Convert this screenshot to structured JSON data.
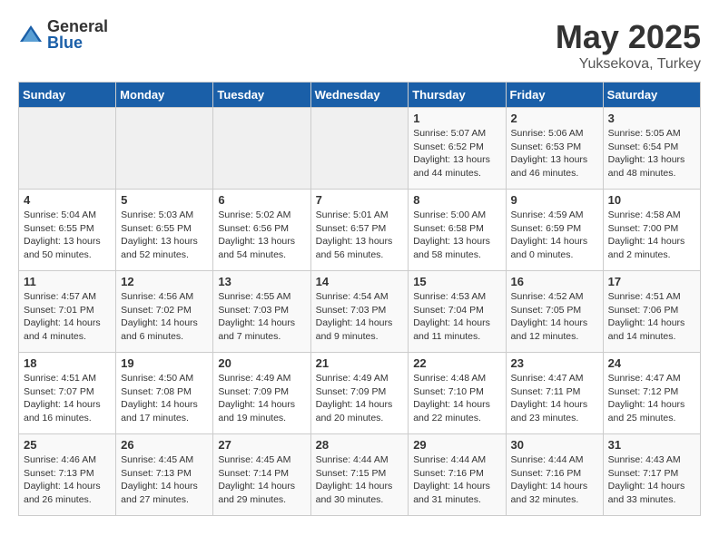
{
  "logo": {
    "general": "General",
    "blue": "Blue"
  },
  "title": "May 2025",
  "location": "Yuksekova, Turkey",
  "days_of_week": [
    "Sunday",
    "Monday",
    "Tuesday",
    "Wednesday",
    "Thursday",
    "Friday",
    "Saturday"
  ],
  "weeks": [
    [
      {
        "day": "",
        "info": ""
      },
      {
        "day": "",
        "info": ""
      },
      {
        "day": "",
        "info": ""
      },
      {
        "day": "",
        "info": ""
      },
      {
        "day": "1",
        "info": "Sunrise: 5:07 AM\nSunset: 6:52 PM\nDaylight: 13 hours\nand 44 minutes."
      },
      {
        "day": "2",
        "info": "Sunrise: 5:06 AM\nSunset: 6:53 PM\nDaylight: 13 hours\nand 46 minutes."
      },
      {
        "day": "3",
        "info": "Sunrise: 5:05 AM\nSunset: 6:54 PM\nDaylight: 13 hours\nand 48 minutes."
      }
    ],
    [
      {
        "day": "4",
        "info": "Sunrise: 5:04 AM\nSunset: 6:55 PM\nDaylight: 13 hours\nand 50 minutes."
      },
      {
        "day": "5",
        "info": "Sunrise: 5:03 AM\nSunset: 6:55 PM\nDaylight: 13 hours\nand 52 minutes."
      },
      {
        "day": "6",
        "info": "Sunrise: 5:02 AM\nSunset: 6:56 PM\nDaylight: 13 hours\nand 54 minutes."
      },
      {
        "day": "7",
        "info": "Sunrise: 5:01 AM\nSunset: 6:57 PM\nDaylight: 13 hours\nand 56 minutes."
      },
      {
        "day": "8",
        "info": "Sunrise: 5:00 AM\nSunset: 6:58 PM\nDaylight: 13 hours\nand 58 minutes."
      },
      {
        "day": "9",
        "info": "Sunrise: 4:59 AM\nSunset: 6:59 PM\nDaylight: 14 hours\nand 0 minutes."
      },
      {
        "day": "10",
        "info": "Sunrise: 4:58 AM\nSunset: 7:00 PM\nDaylight: 14 hours\nand 2 minutes."
      }
    ],
    [
      {
        "day": "11",
        "info": "Sunrise: 4:57 AM\nSunset: 7:01 PM\nDaylight: 14 hours\nand 4 minutes."
      },
      {
        "day": "12",
        "info": "Sunrise: 4:56 AM\nSunset: 7:02 PM\nDaylight: 14 hours\nand 6 minutes."
      },
      {
        "day": "13",
        "info": "Sunrise: 4:55 AM\nSunset: 7:03 PM\nDaylight: 14 hours\nand 7 minutes."
      },
      {
        "day": "14",
        "info": "Sunrise: 4:54 AM\nSunset: 7:03 PM\nDaylight: 14 hours\nand 9 minutes."
      },
      {
        "day": "15",
        "info": "Sunrise: 4:53 AM\nSunset: 7:04 PM\nDaylight: 14 hours\nand 11 minutes."
      },
      {
        "day": "16",
        "info": "Sunrise: 4:52 AM\nSunset: 7:05 PM\nDaylight: 14 hours\nand 12 minutes."
      },
      {
        "day": "17",
        "info": "Sunrise: 4:51 AM\nSunset: 7:06 PM\nDaylight: 14 hours\nand 14 minutes."
      }
    ],
    [
      {
        "day": "18",
        "info": "Sunrise: 4:51 AM\nSunset: 7:07 PM\nDaylight: 14 hours\nand 16 minutes."
      },
      {
        "day": "19",
        "info": "Sunrise: 4:50 AM\nSunset: 7:08 PM\nDaylight: 14 hours\nand 17 minutes."
      },
      {
        "day": "20",
        "info": "Sunrise: 4:49 AM\nSunset: 7:09 PM\nDaylight: 14 hours\nand 19 minutes."
      },
      {
        "day": "21",
        "info": "Sunrise: 4:49 AM\nSunset: 7:09 PM\nDaylight: 14 hours\nand 20 minutes."
      },
      {
        "day": "22",
        "info": "Sunrise: 4:48 AM\nSunset: 7:10 PM\nDaylight: 14 hours\nand 22 minutes."
      },
      {
        "day": "23",
        "info": "Sunrise: 4:47 AM\nSunset: 7:11 PM\nDaylight: 14 hours\nand 23 minutes."
      },
      {
        "day": "24",
        "info": "Sunrise: 4:47 AM\nSunset: 7:12 PM\nDaylight: 14 hours\nand 25 minutes."
      }
    ],
    [
      {
        "day": "25",
        "info": "Sunrise: 4:46 AM\nSunset: 7:13 PM\nDaylight: 14 hours\nand 26 minutes."
      },
      {
        "day": "26",
        "info": "Sunrise: 4:45 AM\nSunset: 7:13 PM\nDaylight: 14 hours\nand 27 minutes."
      },
      {
        "day": "27",
        "info": "Sunrise: 4:45 AM\nSunset: 7:14 PM\nDaylight: 14 hours\nand 29 minutes."
      },
      {
        "day": "28",
        "info": "Sunrise: 4:44 AM\nSunset: 7:15 PM\nDaylight: 14 hours\nand 30 minutes."
      },
      {
        "day": "29",
        "info": "Sunrise: 4:44 AM\nSunset: 7:16 PM\nDaylight: 14 hours\nand 31 minutes."
      },
      {
        "day": "30",
        "info": "Sunrise: 4:44 AM\nSunset: 7:16 PM\nDaylight: 14 hours\nand 32 minutes."
      },
      {
        "day": "31",
        "info": "Sunrise: 4:43 AM\nSunset: 7:17 PM\nDaylight: 14 hours\nand 33 minutes."
      }
    ]
  ]
}
